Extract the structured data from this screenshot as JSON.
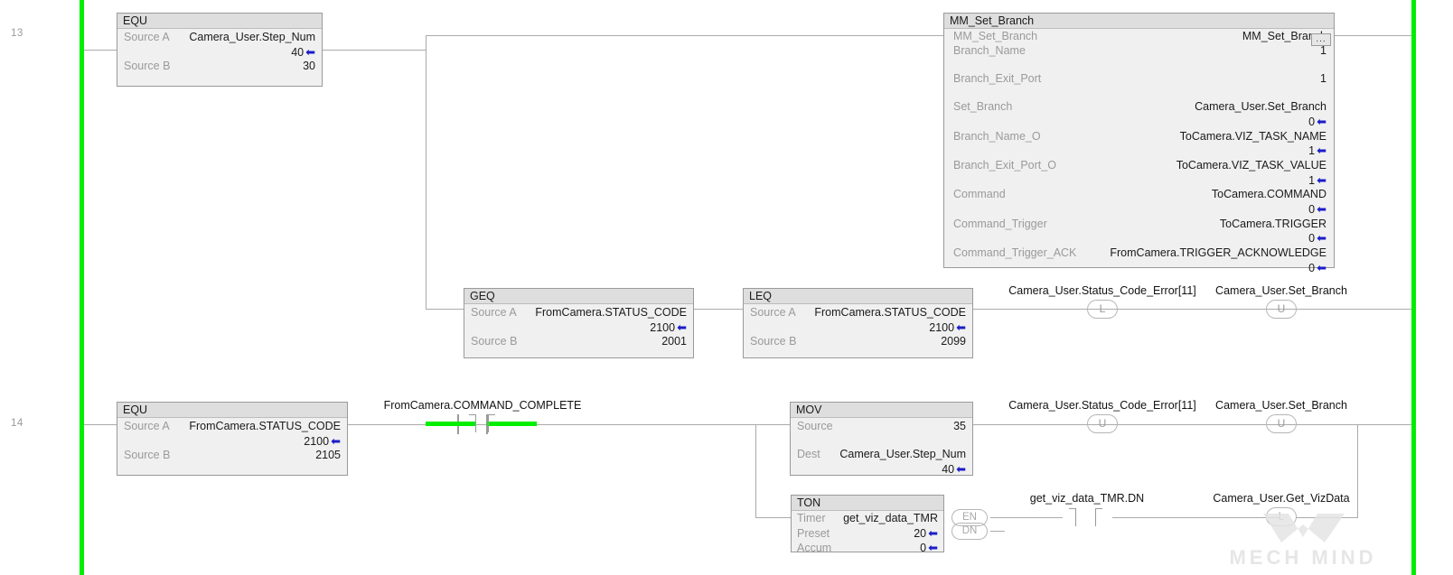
{
  "app": {
    "type": "ladder-logic-editor",
    "watermark": "MECH MIND"
  },
  "rungs": [
    {
      "number": "13",
      "blocks": {
        "equ": {
          "title": "EQU",
          "rows": [
            {
              "label": "Source A",
              "tag": "Camera_User.Step_Num",
              "value": "40",
              "arrow": true
            },
            {
              "label": "Source B",
              "tag": "",
              "value": "30",
              "arrow": false
            }
          ]
        },
        "geq": {
          "title": "GEQ",
          "rows": [
            {
              "label": "Source A",
              "tag": "FromCamera.STATUS_CODE",
              "value": "2100",
              "arrow": true
            },
            {
              "label": "Source B",
              "tag": "",
              "value": "2001",
              "arrow": false
            }
          ]
        },
        "leq": {
          "title": "LEQ",
          "rows": [
            {
              "label": "Source A",
              "tag": "FromCamera.STATUS_CODE",
              "value": "2100",
              "arrow": true
            },
            {
              "label": "Source B",
              "tag": "",
              "value": "2099",
              "arrow": false
            }
          ]
        },
        "mm_set_branch": {
          "title": "MM_Set_Branch",
          "ellipsis": "...",
          "rows": [
            {
              "label": "MM_Set_Branch",
              "value": "MM_Set_Branch",
              "sub": "",
              "arrow": false
            },
            {
              "label": "Branch_Name",
              "value": "1",
              "sub": "",
              "arrow": false
            },
            {
              "label": "Branch_Exit_Port",
              "value": "1",
              "sub": "",
              "arrow": false
            },
            {
              "label": "Set_Branch",
              "value": "Camera_User.Set_Branch",
              "sub": "0",
              "arrow": true
            },
            {
              "label": "Branch_Name_O",
              "value": "ToCamera.VIZ_TASK_NAME",
              "sub": "1",
              "arrow": true
            },
            {
              "label": "Branch_Exit_Port_O",
              "value": "ToCamera.VIZ_TASK_VALUE",
              "sub": "1",
              "arrow": true
            },
            {
              "label": "Command",
              "value": "ToCamera.COMMAND",
              "sub": "0",
              "arrow": true
            },
            {
              "label": "Command_Trigger",
              "value": "ToCamera.TRIGGER",
              "sub": "0",
              "arrow": true
            },
            {
              "label": "Command_Trigger_ACK",
              "value": "FromCamera.TRIGGER_ACKNOWLEDGE",
              "sub": "0",
              "arrow": true
            }
          ]
        }
      },
      "coils": [
        {
          "tag": "Camera_User.Status_Code_Error[11]",
          "letter": "L"
        },
        {
          "tag": "Camera_User.Set_Branch",
          "letter": "U"
        }
      ]
    },
    {
      "number": "14",
      "blocks": {
        "equ": {
          "title": "EQU",
          "rows": [
            {
              "label": "Source A",
              "tag": "FromCamera.STATUS_CODE",
              "value": "2100",
              "arrow": true
            },
            {
              "label": "Source B",
              "tag": "",
              "value": "2105",
              "arrow": false
            }
          ]
        },
        "mov": {
          "title": "MOV",
          "rows": [
            {
              "label": "Source",
              "tag": "",
              "value": "35",
              "arrow": false
            },
            {
              "label": "Dest",
              "tag": "Camera_User.Step_Num",
              "value": "40",
              "arrow": true
            }
          ]
        },
        "ton": {
          "title": "TON",
          "rows": [
            {
              "label": "Timer",
              "tag": "get_viz_data_TMR",
              "value": "",
              "arrow": false
            },
            {
              "label": "Preset",
              "tag": "",
              "value": "20",
              "arrow": true
            },
            {
              "label": "Accum",
              "tag": "",
              "value": "0",
              "arrow": true
            }
          ],
          "outputs": [
            "EN",
            "DN"
          ]
        }
      },
      "contacts": [
        {
          "tag": "FromCamera.COMMAND_COMPLETE",
          "energized": true
        },
        {
          "tag": "get_viz_data_TMR.DN",
          "energized": false
        }
      ],
      "coils": [
        {
          "tag": "Camera_User.Status_Code_Error[11]",
          "letter": "U"
        },
        {
          "tag": "Camera_User.Set_Branch",
          "letter": "U"
        },
        {
          "tag": "Camera_User.Get_VizData",
          "letter": "L"
        }
      ]
    }
  ],
  "colors": {
    "rail_energized": "#00ee00",
    "wire": "#aaaaaa",
    "box_header": "#dedede",
    "box_body": "#f0f0f0",
    "label_text": "#9a9a9a",
    "value_text": "#1a1a1a",
    "arrow_marker": "#1c1cc8"
  }
}
